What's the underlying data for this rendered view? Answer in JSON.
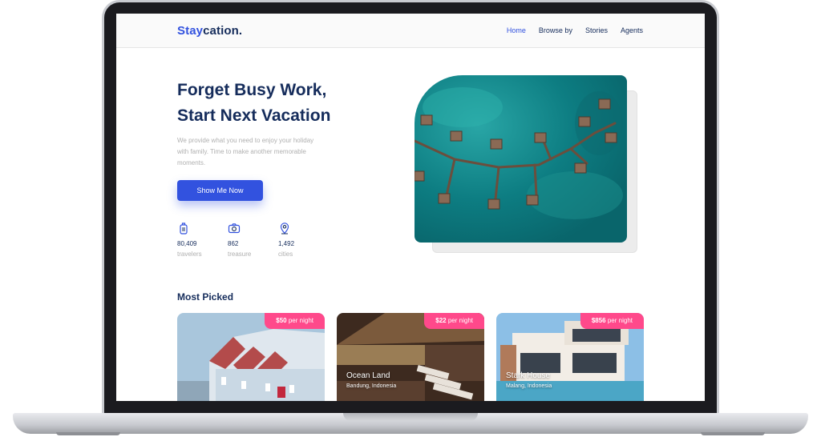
{
  "brand": {
    "name_accent": "Stay",
    "name_rest": "cation."
  },
  "nav": {
    "items": [
      {
        "label": "Home",
        "active": true
      },
      {
        "label": "Browse by",
        "active": false
      },
      {
        "label": "Stories",
        "active": false
      },
      {
        "label": "Agents",
        "active": false
      }
    ]
  },
  "hero": {
    "title_line1": "Forget Busy Work,",
    "title_line2": "Start Next Vacation",
    "description": "We provide what you need to enjoy your holiday with family. Time to make another memorable moments.",
    "cta_label": "Show Me Now",
    "stats": [
      {
        "icon": "luggage-icon",
        "value": "80,409",
        "label": "travelers"
      },
      {
        "icon": "camera-icon",
        "value": "862",
        "label": "treasure"
      },
      {
        "icon": "map-pin-icon",
        "value": "1,492",
        "label": "cities"
      }
    ]
  },
  "most_picked": {
    "title": "Most Picked",
    "cards": [
      {
        "price": "$50",
        "price_unit": "per night",
        "name": "",
        "location": ""
      },
      {
        "price": "$22",
        "price_unit": "per night",
        "name": "Ocean Land",
        "location": "Bandung, Indonesia"
      },
      {
        "price": "$856",
        "price_unit": "per night",
        "name": "Stark House",
        "location": "Malang, Indonesia"
      }
    ]
  },
  "colors": {
    "primary": "#3252df",
    "navy": "#152c5b",
    "muted": "#b0b0b0",
    "pink": "#ff498b"
  }
}
